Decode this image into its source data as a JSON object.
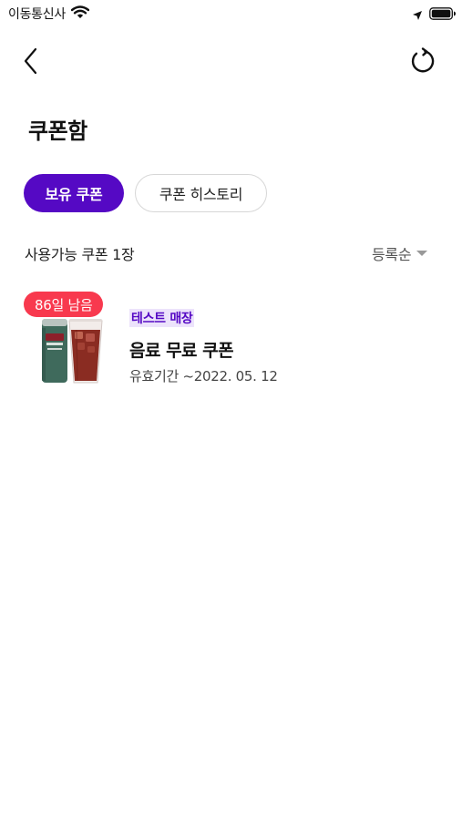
{
  "status_bar": {
    "carrier": "이동통신사",
    "wifi_icon": "wifi-icon",
    "location_icon": "location-arrow-icon",
    "battery_icon": "battery-icon"
  },
  "nav": {
    "back_icon": "chevron-left-icon",
    "refresh_icon": "refresh-icon"
  },
  "page": {
    "title": "쿠폰함"
  },
  "tabs": [
    {
      "label": "보유 쿠폰",
      "active": true
    },
    {
      "label": "쿠폰 히스토리",
      "active": false
    }
  ],
  "list_header": {
    "count_text": "사용가능 쿠폰 1장",
    "sort_value": "등록순"
  },
  "coupons": [
    {
      "days_left": "86일 남음",
      "store": "테스트 매장",
      "name": "음료 무료 쿠폰",
      "validity": "유효기간 ~2022. 05. 12",
      "image_icon": "drink-can-and-iced-coffee-image"
    }
  ],
  "colors": {
    "accent": "#5509c4",
    "badge": "#f8394e",
    "store_highlight": "#ece3fb"
  }
}
